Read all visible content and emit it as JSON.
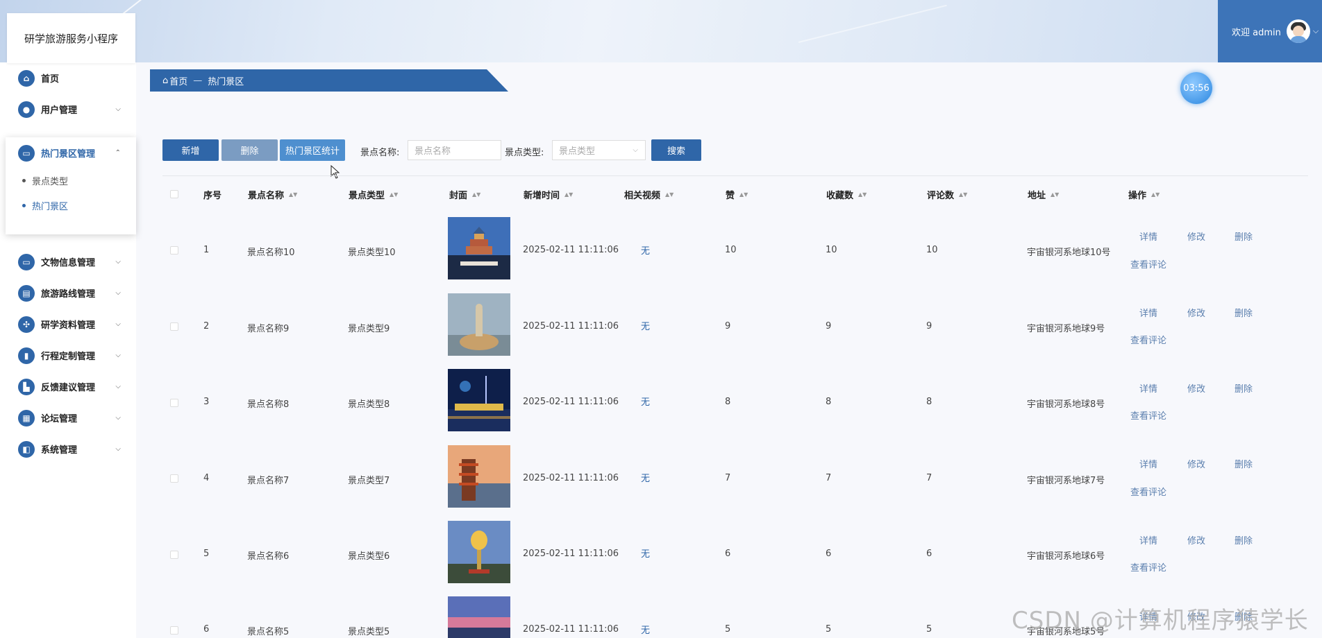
{
  "app": {
    "title": "研学旅游服务小程序"
  },
  "user": {
    "welcome": "欢迎 admin"
  },
  "timer": "03:56",
  "sidebar": {
    "items": [
      {
        "label": "首页"
      },
      {
        "label": "用户管理"
      },
      {
        "label": "热门景区管理"
      },
      {
        "label": "文物信息管理"
      },
      {
        "label": "旅游路线管理"
      },
      {
        "label": "研学资料管理"
      },
      {
        "label": "行程定制管理"
      },
      {
        "label": "反馈建议管理"
      },
      {
        "label": "论坛管理"
      },
      {
        "label": "系统管理"
      }
    ],
    "subitems": [
      {
        "label": "景点类型"
      },
      {
        "label": "热门景区"
      }
    ]
  },
  "breadcrumb": {
    "home": "首页",
    "separator": "—",
    "current": "热门景区"
  },
  "toolbar": {
    "add": "新增",
    "delete": "删除",
    "stats": "热门景区统计",
    "name_label": "景点名称:",
    "name_placeholder": "景点名称",
    "type_label": "景点类型:",
    "type_placeholder": "景点类型",
    "search": "搜索"
  },
  "table": {
    "headers": [
      "序号",
      "景点名称",
      "景点类型",
      "封面",
      "新增时间",
      "相关视频",
      "赞",
      "收藏数",
      "评论数",
      "地址",
      "操作"
    ],
    "actions": {
      "detail": "详情",
      "edit": "修改",
      "delete": "删除",
      "comments": "查看评论"
    },
    "rows": [
      {
        "no": "1",
        "name": "景点名称10",
        "type": "景点类型10",
        "time": "2025-02-11 11:11:06",
        "video": "无",
        "likes": "10",
        "favorites": "10",
        "comments": "10",
        "address": "宇宙银河系地球10号",
        "thumb": "temple-icon"
      },
      {
        "no": "2",
        "name": "景点名称9",
        "type": "景点类型9",
        "time": "2025-02-11 11:11:06",
        "video": "无",
        "likes": "9",
        "favorites": "9",
        "comments": "9",
        "address": "宇宙银河系地球9号",
        "thumb": "statue-icon"
      },
      {
        "no": "3",
        "name": "景点名称8",
        "type": "景点类型8",
        "time": "2025-02-11 11:11:06",
        "video": "无",
        "likes": "8",
        "favorites": "8",
        "comments": "8",
        "address": "宇宙银河系地球8号",
        "thumb": "city-night-icon"
      },
      {
        "no": "4",
        "name": "景点名称7",
        "type": "景点类型7",
        "time": "2025-02-11 11:11:06",
        "video": "无",
        "likes": "7",
        "favorites": "7",
        "comments": "7",
        "address": "宇宙银河系地球7号",
        "thumb": "pagoda-icon"
      },
      {
        "no": "5",
        "name": "景点名称6",
        "type": "景点类型6",
        "time": "2025-02-11 11:11:06",
        "video": "无",
        "likes": "6",
        "favorites": "6",
        "comments": "6",
        "address": "宇宙银河系地球6号",
        "thumb": "lotus-sculpture-icon"
      },
      {
        "no": "6",
        "name": "景点名称5",
        "type": "景点类型5",
        "time": "2025-02-11 11:11:06",
        "video": "无",
        "likes": "5",
        "favorites": "5",
        "comments": "5",
        "address": "宇宙银河系地球5号",
        "thumb": "sunset-icon"
      }
    ]
  },
  "watermark": "CSDN @计算机程序猿学长",
  "colors": {
    "primary": "#2f66a8",
    "header_user_bg": "#3d74b8"
  }
}
